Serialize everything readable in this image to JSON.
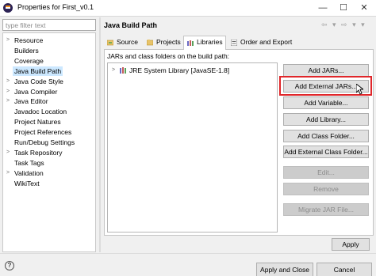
{
  "window": {
    "title": "Properties for First_v0.1",
    "min_glyph": "—",
    "max_glyph": "☐",
    "close_glyph": "✕"
  },
  "filter": {
    "placeholder": "type filter text",
    "value": ""
  },
  "nav": {
    "items": [
      {
        "label": "Resource",
        "expandable": true
      },
      {
        "label": "Builders",
        "expandable": false
      },
      {
        "label": "Coverage",
        "expandable": false
      },
      {
        "label": "Java Build Path",
        "expandable": false,
        "selected": true
      },
      {
        "label": "Java Code Style",
        "expandable": true
      },
      {
        "label": "Java Compiler",
        "expandable": true
      },
      {
        "label": "Java Editor",
        "expandable": true
      },
      {
        "label": "Javadoc Location",
        "expandable": false
      },
      {
        "label": "Project Natures",
        "expandable": false
      },
      {
        "label": "Project References",
        "expandable": false
      },
      {
        "label": "Run/Debug Settings",
        "expandable": false
      },
      {
        "label": "Task Repository",
        "expandable": true
      },
      {
        "label": "Task Tags",
        "expandable": false
      },
      {
        "label": "Validation",
        "expandable": true
      },
      {
        "label": "WikiText",
        "expandable": false
      }
    ],
    "expand_glyph": ">"
  },
  "page": {
    "title": "Java Build Path",
    "nav_arrows": "⇦ ▾ ⇨ ▾ ▾"
  },
  "tabs": [
    {
      "label": "Source",
      "icon": "source-folder-icon"
    },
    {
      "label": "Projects",
      "icon": "projects-icon"
    },
    {
      "label": "Libraries",
      "icon": "libraries-icon",
      "active": true
    },
    {
      "label": "Order and Export",
      "icon": "order-export-icon"
    }
  ],
  "libraries": {
    "label": "JARs and class folders on the build path:",
    "entries": [
      {
        "label": "JRE System Library [JavaSE-1.8]",
        "icon": "jre-library-icon"
      }
    ]
  },
  "buttons": {
    "add_jars": "Add JARs...",
    "add_external_jars": "Add External JARs...",
    "add_variable": "Add Variable...",
    "add_library": "Add Library...",
    "add_class_folder": "Add Class Folder...",
    "add_external_class_folder": "Add External Class Folder...",
    "edit": "Edit...",
    "remove": "Remove",
    "migrate_jar": "Migrate JAR File...",
    "apply": "Apply",
    "apply_and_close": "Apply and Close",
    "cancel": "Cancel",
    "help": "?"
  },
  "colors": {
    "highlight": "#e0262a",
    "selection": "#cce8ff"
  }
}
